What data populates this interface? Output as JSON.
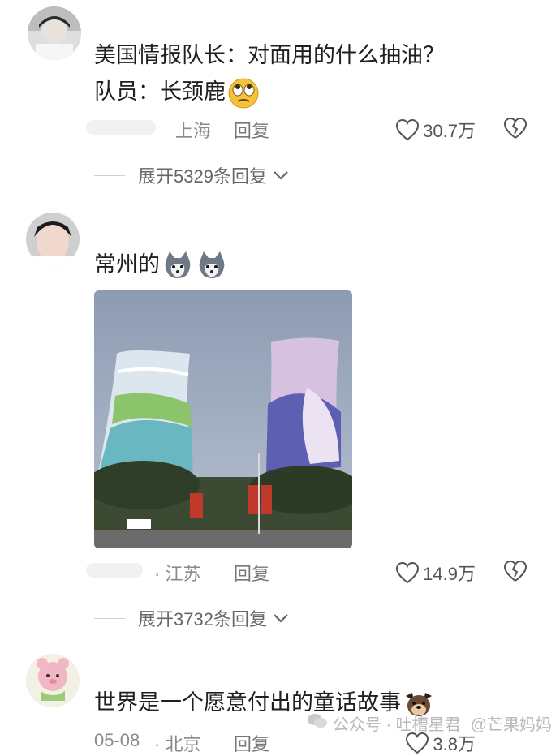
{
  "comments": [
    {
      "text_lines": [
        "美国情报队长：对面用的什么抽油？",
        "队员：长颈鹿"
      ],
      "emoji": "rolling-eyes-emoji",
      "location": "上海",
      "reply_label": "回复",
      "likes": "30.7万",
      "expand_label": "展开5329条回复"
    },
    {
      "text": "常州的",
      "emoji": "husky-emoji",
      "location": "· 江苏",
      "reply_label": "回复",
      "likes": "14.9万",
      "expand_label": "展开3732条回复"
    },
    {
      "text": "世界是一个愿意付出的童话故事",
      "emoji": "dog-emoji",
      "date": "05-08",
      "location": "· 北京",
      "reply_label": "回复",
      "likes": "3.8万"
    }
  ],
  "watermark": {
    "text": "公众号 · 吐槽星君",
    "text2": "@芒果妈妈"
  },
  "colors": {
    "text": "#1f1f1f",
    "meta": "#8a8a8a",
    "background": "#ffffff"
  }
}
